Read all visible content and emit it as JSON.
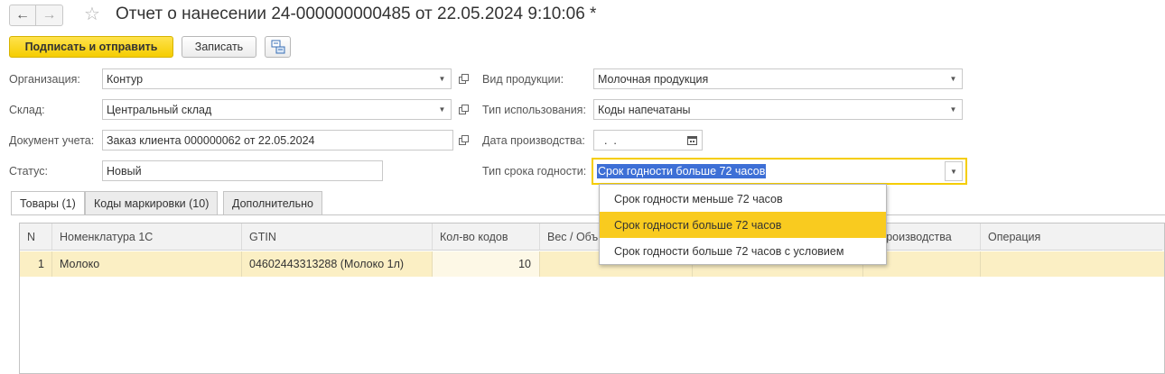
{
  "window": {
    "title": "Отчет о нанесении 24-000000000485 от 22.05.2024 9:10:06 *",
    "back_glyph": "←",
    "forward_glyph": "→",
    "star_glyph": "☆"
  },
  "toolbar": {
    "sign_send_label": "Подписать и отправить",
    "save_label": "Записать"
  },
  "form": {
    "organization": {
      "label": "Организация:",
      "value": "Контур"
    },
    "warehouse": {
      "label": "Склад:",
      "value": "Центральный склад"
    },
    "accounting_doc": {
      "label": "Документ учета:",
      "value": "Заказ клиента 000000062 от 22.05.2024"
    },
    "status": {
      "label": "Статус:",
      "value": "Новый"
    },
    "product_type": {
      "label": "Вид продукции:",
      "value": "Молочная продукция"
    },
    "usage_type": {
      "label": "Тип использования:",
      "value": "Коды напечатаны"
    },
    "production_date": {
      "label": "Дата производства:",
      "value": "  .  ."
    },
    "shelf_life_type": {
      "label": "Тип срока годности:",
      "value": "Срок годности больше 72 часов"
    }
  },
  "tabs": [
    {
      "label": "Товары (1)",
      "active": true
    },
    {
      "label": "Коды маркировки (10)",
      "active": false
    },
    {
      "label": "Дополнительно",
      "active": false
    }
  ],
  "table": {
    "columns": [
      "N",
      "Номенклатура 1С",
      "GTIN",
      "Кол-во кодов",
      "Вес / Объ",
      "",
      "а производства",
      "Операция"
    ],
    "rows": [
      {
        "n": "1",
        "nomenclature": "Молоко",
        "gtin": "04602443313288 (Молоко 1л)",
        "count": "10"
      }
    ]
  },
  "dropdown": {
    "options": [
      "Срок годности меньше 72 часов",
      "Срок годности больше 72 часов",
      "Срок годности больше 72 часов с условием"
    ],
    "selected_index": 1
  },
  "colors": {
    "accent_yellow": "#f9cb1f",
    "selected_row": "#fbefc4",
    "text_selection": "#3d6fd6"
  }
}
